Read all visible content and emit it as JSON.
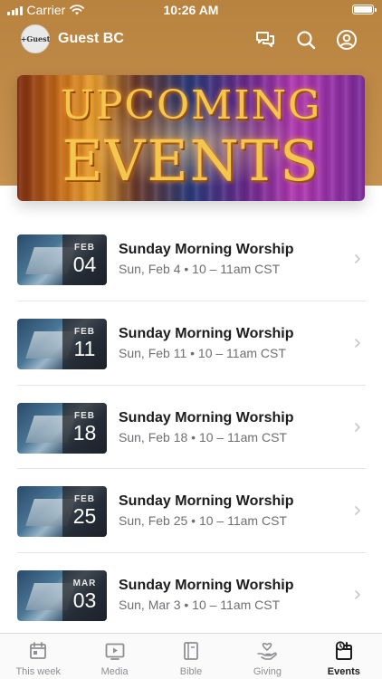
{
  "status_bar": {
    "carrier": "Carrier",
    "time": "10:26 AM"
  },
  "header": {
    "title": "Guest BC",
    "avatar_text": "+Guest",
    "icons": [
      "chat-icon",
      "search-icon",
      "profile-icon"
    ]
  },
  "banner": {
    "line1": "UPCOMING",
    "line2": "EVENTS"
  },
  "events": [
    {
      "month": "FEB",
      "day": "04",
      "title": "Sunday Morning Worship",
      "time": "Sun, Feb 4 • 10 – 11am CST"
    },
    {
      "month": "FEB",
      "day": "11",
      "title": "Sunday Morning Worship",
      "time": "Sun, Feb 11 • 10 – 11am CST"
    },
    {
      "month": "FEB",
      "day": "18",
      "title": "Sunday Morning Worship",
      "time": "Sun, Feb 18 • 10 – 11am CST"
    },
    {
      "month": "FEB",
      "day": "25",
      "title": "Sunday Morning Worship",
      "time": "Sun, Feb 25 • 10 – 11am CST"
    },
    {
      "month": "MAR",
      "day": "03",
      "title": "Sunday Morning Worship",
      "time": "Sun, Mar 3 • 10 – 11am CST"
    }
  ],
  "tabs": [
    {
      "label": "This week",
      "icon": "calendar-icon"
    },
    {
      "label": "Media",
      "icon": "play-icon"
    },
    {
      "label": "Bible",
      "icon": "bible-icon"
    },
    {
      "label": "Giving",
      "icon": "giving-icon"
    },
    {
      "label": "Events",
      "icon": "events-icon",
      "active": true
    }
  ],
  "colors": {
    "header_bg": "#c08b48",
    "text_primary": "#1c1c1e",
    "text_secondary": "#6e6e73",
    "tab_inactive": "#8e8e93"
  }
}
